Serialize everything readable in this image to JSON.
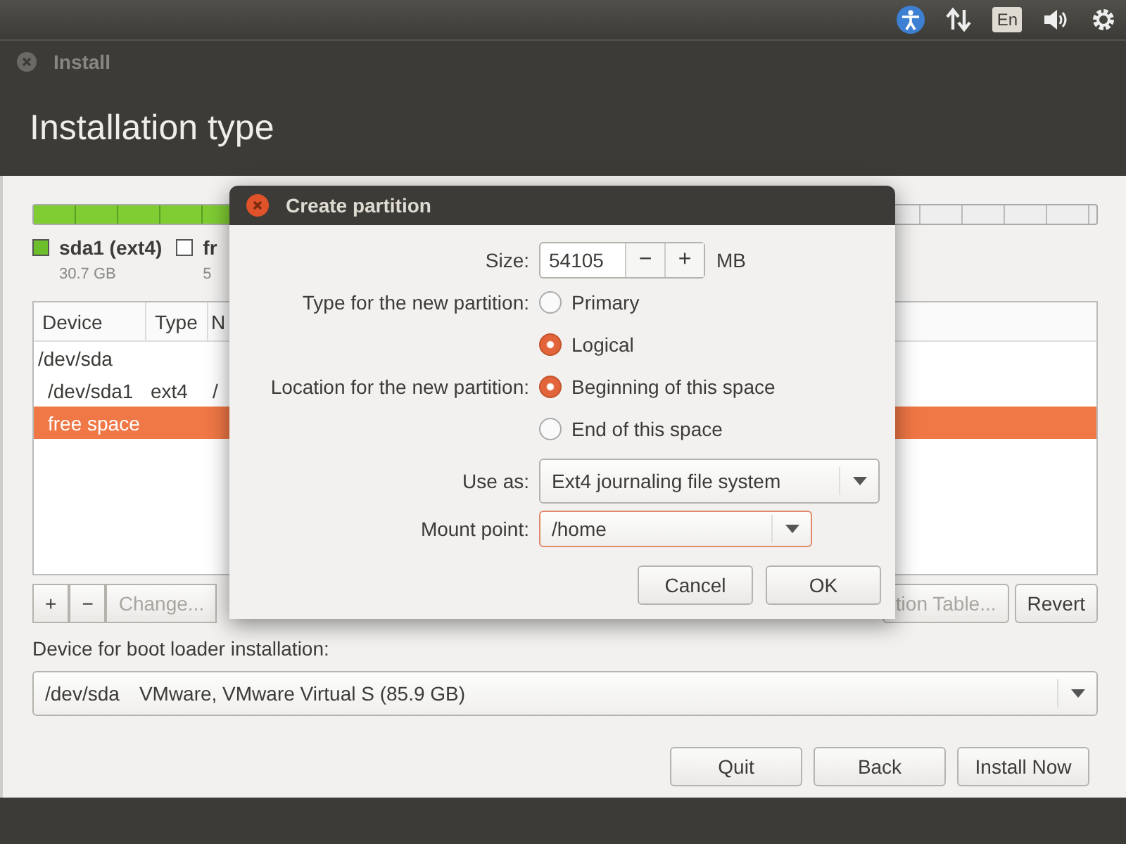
{
  "top_panel": {
    "keyboard_layout": "En"
  },
  "window": {
    "title": "Install",
    "heading": "Installation type"
  },
  "partition_bar": {
    "level": 0.357
  },
  "legend": [
    {
      "label": "sda1 (ext4)",
      "size": "30.7 GB",
      "color": "#6cbf2a"
    },
    {
      "label": "fr",
      "size": "5",
      "color": "#ffffff"
    }
  ],
  "table": {
    "columns": [
      "Device",
      "Type",
      "N"
    ],
    "rows": [
      {
        "cells": [
          "/dev/sda"
        ],
        "selected": false,
        "children": [
          {
            "cells": [
              "/dev/sda1",
              "ext4",
              "/"
            ],
            "selected": false
          },
          {
            "cells": [
              "free space"
            ],
            "selected": true
          }
        ]
      }
    ]
  },
  "table_buttons": [
    {
      "label": "+",
      "disabled": false
    },
    {
      "label": "−",
      "disabled": false
    },
    {
      "label": "Change...",
      "disabled": true
    }
  ],
  "table_buttons_right": [
    {
      "label": "tion Table...",
      "disabled": true
    },
    {
      "label": "Revert",
      "disabled": false
    }
  ],
  "boot_loader": {
    "label": "Device for boot loader installation:",
    "device": "/dev/sda",
    "description": "VMware, VMware Virtual S (85.9 GB)"
  },
  "buttons": [
    "Quit",
    "Back",
    "Install Now"
  ],
  "dialog": {
    "title": "Create partition",
    "size": {
      "label": "Size:",
      "value": "54105",
      "minus": "−",
      "plus": "+",
      "unit": "MB"
    },
    "type": {
      "label": "Type for the new partition:",
      "options": [
        {
          "label": "Primary",
          "selected": false
        },
        {
          "label": "Logical",
          "selected": true
        }
      ]
    },
    "location": {
      "label": "Location for the new partition:",
      "options": [
        {
          "label": "Beginning of this space",
          "selected": true
        },
        {
          "label": "End of this space",
          "selected": false
        }
      ]
    },
    "use_as": {
      "label": "Use as:",
      "value": "Ext4 journaling file system"
    },
    "mount_point": {
      "label": "Mount point:",
      "value": "/home"
    },
    "buttons": [
      "Cancel",
      "OK"
    ]
  }
}
